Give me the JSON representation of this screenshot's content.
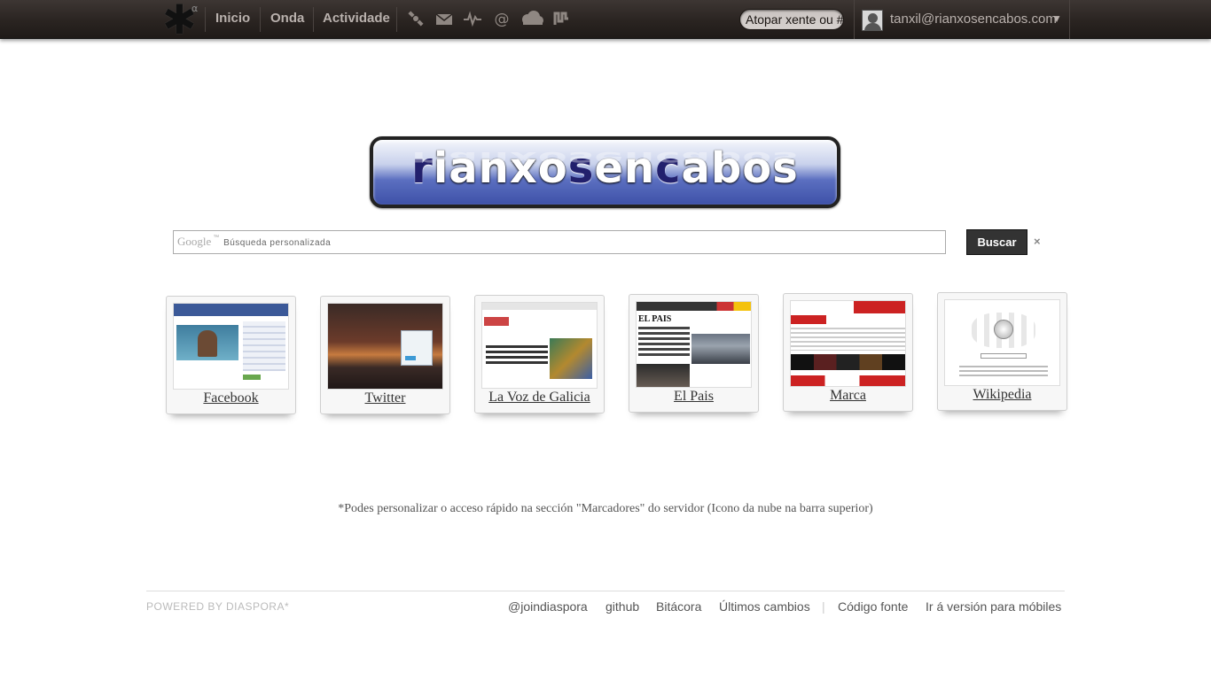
{
  "header": {
    "logo_alpha": "α",
    "nav": [
      "Inicio",
      "Onda",
      "Actividade"
    ],
    "icons": [
      "satellite-icon",
      "mail-icon",
      "pulse-icon",
      "at-icon",
      "cloud-icon",
      "mu-icon"
    ],
    "search_placeholder": "Atopar xente ou #",
    "user_email": "tanxil@rianxosencabos.com",
    "user_caret": "▼"
  },
  "banner": {
    "text_parts": [
      "r",
      "ianxo",
      "s",
      "en",
      "c",
      "abos"
    ]
  },
  "google_search": {
    "logo": "Google",
    "logo_tm": "™",
    "placeholder": "Búsqueda personalizada",
    "button": "Buscar",
    "clear": "×"
  },
  "speed_dial": [
    {
      "label": "Facebook"
    },
    {
      "label": "Twitter"
    },
    {
      "label": "La Voz de Galicia"
    },
    {
      "label": "El Pais"
    },
    {
      "label": "Marca"
    },
    {
      "label": "Wikipedia"
    }
  ],
  "note": "*Podes personalizar o acceso rápido na sección \"Marcadores\" do servidor (Icono da nube na barra superior)",
  "footer": {
    "powered": "POWERED BY DIASPORA*",
    "links": [
      "@joindiaspora",
      "github",
      "Bitácora",
      "Últimos cambios",
      "Código fonte",
      "Ir á versión para móbiles"
    ],
    "separator": "|"
  },
  "colors": {
    "header_bg": "#2a2421",
    "nav_text": "#b9b1ad",
    "button_bg": "#333333",
    "banner_blue": "#3e51a8"
  }
}
